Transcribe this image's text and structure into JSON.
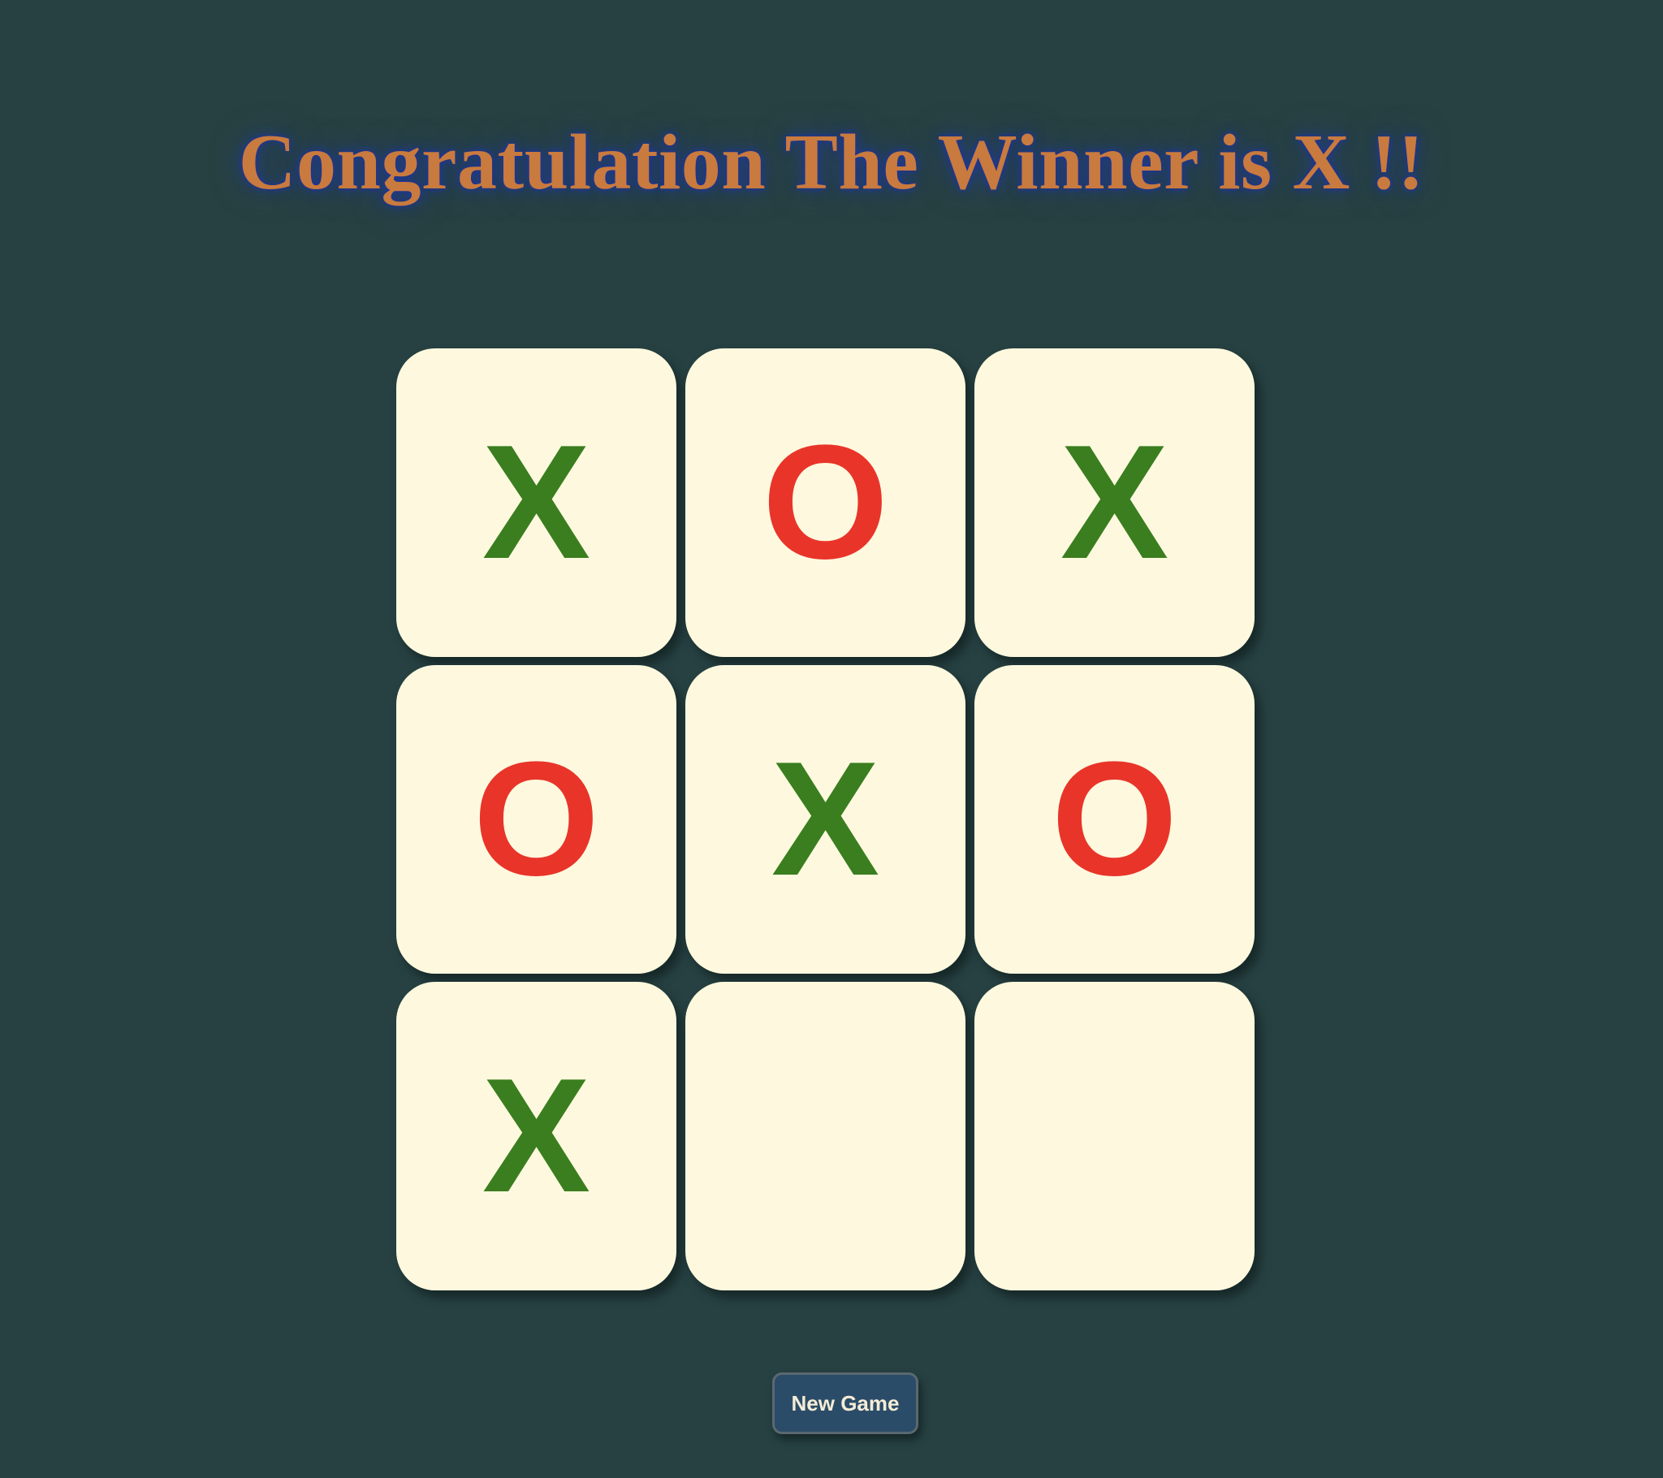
{
  "header": {
    "title": "Congratulation The Winner is X !!"
  },
  "board": {
    "cells": [
      {
        "mark": "X"
      },
      {
        "mark": "O"
      },
      {
        "mark": "X"
      },
      {
        "mark": "O"
      },
      {
        "mark": "X"
      },
      {
        "mark": "O"
      },
      {
        "mark": "X"
      },
      {
        "mark": ""
      },
      {
        "mark": ""
      }
    ]
  },
  "controls": {
    "new_game_label": "New Game"
  },
  "colors": {
    "background": "#274142",
    "cell": "#fef9de",
    "x_mark": "#3a7e1f",
    "o_mark": "#e9342a",
    "title": "#c97a3e",
    "button": "#2b4c68"
  }
}
